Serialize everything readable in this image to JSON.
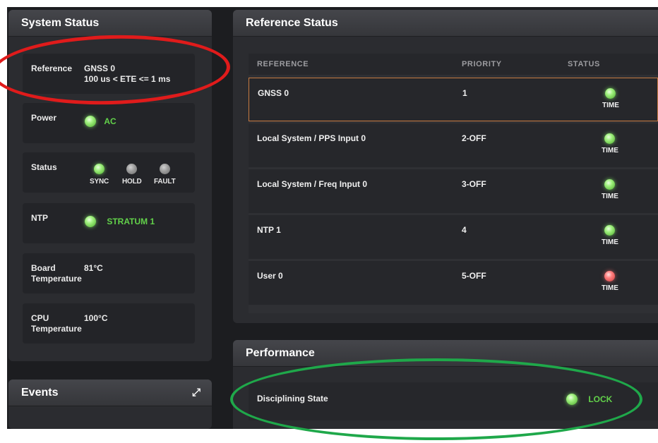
{
  "system_status": {
    "title": "System Status",
    "reference": {
      "label": "Reference",
      "value_line1": "GNSS 0",
      "value_line2": "100 us < ETE <= 1 ms"
    },
    "power": {
      "label": "Power",
      "value": "AC"
    },
    "status": {
      "label": "Status",
      "indicators": [
        "SYNC",
        "HOLD",
        "FAULT"
      ]
    },
    "ntp": {
      "label": "NTP",
      "value": "STRATUM 1"
    },
    "board_temp": {
      "label_line1": "Board",
      "label_line2": "Temperature",
      "value": "81°C"
    },
    "cpu_temp": {
      "label_line1": "CPU",
      "label_line2": "Temperature",
      "value": "100°C"
    }
  },
  "events": {
    "title": "Events",
    "expand_icon": "expand-icon"
  },
  "reference_status": {
    "title": "Reference Status",
    "columns": [
      "REFERENCE",
      "PRIORITY",
      "STATUS"
    ],
    "rows": [
      {
        "reference": "GNSS 0",
        "priority": "1",
        "status": "TIME",
        "led": "green"
      },
      {
        "reference": "Local System / PPS Input 0",
        "priority": "2-OFF",
        "status": "TIME",
        "led": "green"
      },
      {
        "reference": "Local System / Freq Input 0",
        "priority": "3-OFF",
        "status": "TIME",
        "led": "green"
      },
      {
        "reference": "NTP 1",
        "priority": "4",
        "status": "TIME",
        "led": "green"
      },
      {
        "reference": "User 0",
        "priority": "5-OFF",
        "status": "TIME",
        "led": "red"
      }
    ]
  },
  "performance": {
    "title": "Performance",
    "disciplining_label": "Disciplining State",
    "disciplining_value": "LOCK"
  },
  "colors": {
    "led_green": "#62d14a",
    "led_red": "#e84b4b",
    "highlight_red": "#e01b1b",
    "highlight_green": "#1fa84a",
    "selected_row_border": "#c77a40"
  }
}
